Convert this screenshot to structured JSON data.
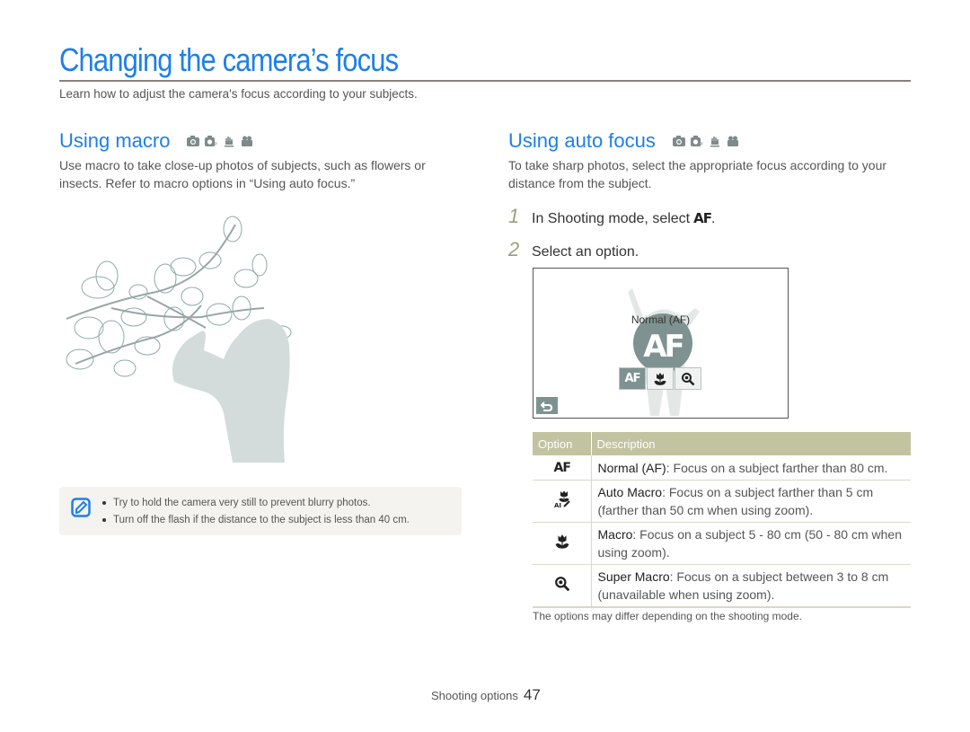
{
  "page": {
    "title": "Changing the camera’s focus",
    "intro": "Learn how to adjust the camera's focus according to your subjects."
  },
  "macro_section": {
    "heading": "Using macro",
    "mode_icons": [
      "camera-auto-icon",
      "camera-program-icon",
      "dual-is-icon",
      "movie-icon"
    ],
    "body": "Use macro to take close-up photos of subjects, such as flowers or insects. Refer to macro options in “Using auto focus.”",
    "illustration": "woman-photographing-magnolia-branch",
    "notes": [
      "Try to hold the camera very still to prevent blurry photos.",
      "Turn off the flash if the distance to the subject is less than 40 cm."
    ]
  },
  "autofocus_section": {
    "heading": "Using auto focus",
    "mode_icons": [
      "camera-auto-icon",
      "camera-program-icon",
      "dual-is-icon",
      "movie-icon"
    ],
    "body": "To take sharp photos, select the appropriate focus according to your distance from the subject.",
    "steps": [
      {
        "number": "1",
        "text": "In Shooting mode, select",
        "icon_text": "AF",
        "suffix": "."
      },
      {
        "number": "2",
        "text": "Select an option.",
        "icon_text": "",
        "suffix": ""
      }
    ],
    "screen": {
      "label": "Normal (AF)",
      "big_icon_text": "AF",
      "options": [
        {
          "icon": "af-icon",
          "text": "AF",
          "selected": true
        },
        {
          "icon": "macro-flower-icon",
          "text": "",
          "selected": false
        },
        {
          "icon": "super-macro-icon",
          "text": "",
          "selected": false
        }
      ],
      "back_icon": "back-arrow-icon"
    },
    "table": {
      "headers": [
        "Option",
        "Description"
      ],
      "rows": [
        {
          "icon": "af-icon",
          "icon_text": "AF",
          "name": "Normal (AF)",
          "desc": ": Focus on a subject farther than 80 cm."
        },
        {
          "icon": "auto-macro-icon",
          "icon_text": "",
          "name": "Auto Macro",
          "desc": ": Focus on a subject farther than 5 cm (farther than 50 cm when using zoom)."
        },
        {
          "icon": "macro-flower-icon",
          "icon_text": "",
          "name": "Macro",
          "desc": ": Focus on a subject 5 - 80 cm (50 - 80 cm when using zoom)."
        },
        {
          "icon": "super-macro-icon",
          "icon_text": "",
          "name": "Super Macro",
          "desc": ": Focus on a subject between 3 to 8 cm (unavailable when using zoom)."
        }
      ],
      "note": "The options may differ depending on the shooting mode."
    }
  },
  "footer": {
    "section": "Shooting options",
    "page_number": "47"
  },
  "colors": {
    "accent": "#1e7fe8",
    "rule": "#8a7f7c",
    "table_header": "#c2c3a0",
    "screen_accent": "#7e9391",
    "note_bg": "#f5f3ef"
  }
}
